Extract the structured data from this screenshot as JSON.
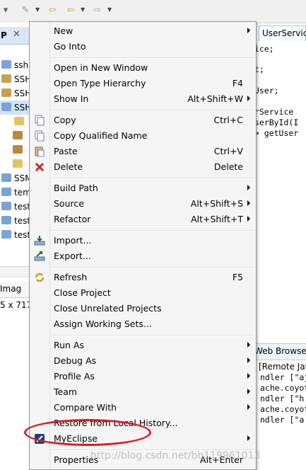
{
  "left_panel": {
    "tab_title": "P",
    "tree": [
      {
        "label": "ssh"
      },
      {
        "label": "SSH"
      },
      {
        "label": "SSH"
      },
      {
        "label": "SSH"
      },
      {
        "label": ""
      },
      {
        "label": ""
      },
      {
        "label": ""
      },
      {
        "label": ""
      },
      {
        "label": "SSM"
      },
      {
        "label": "tem"
      },
      {
        "label": "test"
      },
      {
        "label": "test"
      },
      {
        "label": "test"
      }
    ],
    "image_tab_label": "Imag",
    "image_size_text": "5 x 717"
  },
  "editor": {
    "tab_label": "UserServic",
    "code_lines": [
      "vice;",
      "st;",
      ".User;",
      "erService",
      "UserById(I",
      "r> getUser"
    ]
  },
  "bottom_panel": {
    "tab_label": "Web Browse",
    "console_lines": [
      "[Remote Jav",
      "ndler [\"ajp",
      "ache.coyot",
      "ndler [\"h",
      "ache.coyot",
      "ndler [\"a"
    ]
  },
  "menu": {
    "items": [
      {
        "label": "New",
        "shortcut": "",
        "submenu": true
      },
      {
        "label": "Go Into",
        "shortcut": "",
        "submenu": false
      },
      {
        "label": "Open in New Window",
        "shortcut": "",
        "submenu": false
      },
      {
        "label": "Open Type Hierarchy",
        "shortcut": "F4",
        "submenu": false
      },
      {
        "label": "Show In",
        "shortcut": "Alt+Shift+W",
        "submenu": true
      },
      {
        "label": "Copy",
        "shortcut": "Ctrl+C",
        "submenu": false,
        "icon": "copy-icon"
      },
      {
        "label": "Copy Qualified Name",
        "shortcut": "",
        "submenu": false,
        "icon": "copy-qualified-name-icon"
      },
      {
        "label": "Paste",
        "shortcut": "Ctrl+V",
        "submenu": false,
        "icon": "paste-icon"
      },
      {
        "label": "Delete",
        "shortcut": "Delete",
        "submenu": false,
        "icon": "delete-icon"
      },
      {
        "label": "Build Path",
        "shortcut": "",
        "submenu": true
      },
      {
        "label": "Source",
        "shortcut": "Alt+Shift+S",
        "submenu": true
      },
      {
        "label": "Refactor",
        "shortcut": "Alt+Shift+T",
        "submenu": true
      },
      {
        "label": "Import...",
        "shortcut": "",
        "submenu": false,
        "icon": "import-icon"
      },
      {
        "label": "Export...",
        "shortcut": "",
        "submenu": false,
        "icon": "export-icon"
      },
      {
        "label": "Refresh",
        "shortcut": "F5",
        "submenu": false,
        "icon": "refresh-icon"
      },
      {
        "label": "Close Project",
        "shortcut": "",
        "submenu": false
      },
      {
        "label": "Close Unrelated Projects",
        "shortcut": "",
        "submenu": false
      },
      {
        "label": "Assign Working Sets...",
        "shortcut": "",
        "submenu": false
      },
      {
        "label": "Run As",
        "shortcut": "",
        "submenu": true
      },
      {
        "label": "Debug As",
        "shortcut": "",
        "submenu": true
      },
      {
        "label": "Profile As",
        "shortcut": "",
        "submenu": true
      },
      {
        "label": "Team",
        "shortcut": "",
        "submenu": true
      },
      {
        "label": "Compare With",
        "shortcut": "",
        "submenu": true
      },
      {
        "label": "Restore from Local History...",
        "shortcut": "",
        "submenu": false
      },
      {
        "label": "MyEclipse",
        "shortcut": "",
        "submenu": true,
        "icon": "myeclipse-icon"
      },
      {
        "label": "Properties",
        "shortcut": "Alt+Enter",
        "submenu": false
      }
    ]
  },
  "watermark": "http://blog.csdn.net/bb119961013",
  "colors": {
    "highlight_ellipse": "#e01a22",
    "menu_bg": "#f5f5f5",
    "selection": "#cfe3fb"
  }
}
